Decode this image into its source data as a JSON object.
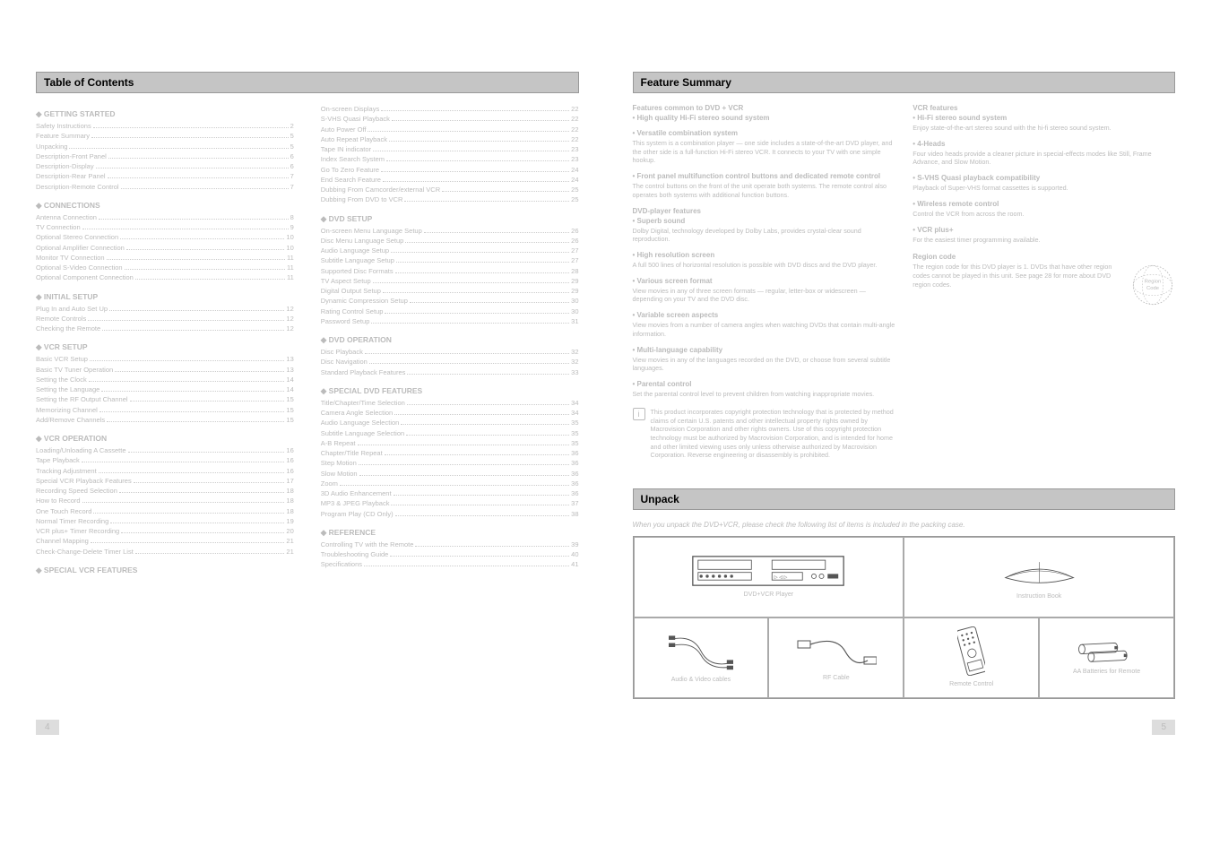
{
  "left": {
    "header": "Table of Contents",
    "sections": [
      {
        "title": "GETTING STARTED",
        "items": [
          {
            "label": "Safety Instructions",
            "page": "2"
          },
          {
            "label": "Feature Summary",
            "page": "5"
          },
          {
            "label": "Unpacking",
            "page": "5"
          },
          {
            "label": "Description-Front Panel",
            "page": "6"
          },
          {
            "label": "Description-Display",
            "page": "6"
          },
          {
            "label": "Description-Rear Panel",
            "page": "7"
          },
          {
            "label": "Description-Remote Control",
            "page": "7"
          }
        ]
      },
      {
        "title": "CONNECTIONS",
        "items": [
          {
            "label": "Antenna Connection",
            "page": "8"
          },
          {
            "label": "TV Connection",
            "page": "9"
          },
          {
            "label": "Optional Stereo Connection",
            "page": "10"
          },
          {
            "label": "Optional Amplifier Connection",
            "page": "10"
          },
          {
            "label": "Monitor TV Connection",
            "page": "11"
          },
          {
            "label": "Optional S-Video Connection",
            "page": "11"
          },
          {
            "label": "Optional Component Connection",
            "page": "11"
          }
        ]
      },
      {
        "title": "INITIAL SETUP",
        "items": [
          {
            "label": "Plug In and Auto Set Up",
            "page": "12"
          },
          {
            "label": "Remote Controls",
            "page": "12"
          },
          {
            "label": "Checking the Remote",
            "page": "12"
          }
        ]
      },
      {
        "title": "VCR SETUP",
        "items": [
          {
            "label": "Basic VCR Setup",
            "page": "13"
          },
          {
            "label": "Basic TV Tuner Operation",
            "page": "13"
          },
          {
            "label": "Setting the Clock",
            "page": "14"
          },
          {
            "label": "Setting the Language",
            "page": "14"
          },
          {
            "label": "Setting the RF Output Channel",
            "page": "15"
          },
          {
            "label": "Memorizing Channel",
            "page": "15"
          },
          {
            "label": "Add/Remove Channels",
            "page": "15"
          }
        ]
      },
      {
        "title": "VCR OPERATION",
        "items": [
          {
            "label": "Loading/Unloading A Cassette",
            "page": "16"
          },
          {
            "label": "Tape Playback",
            "page": "16"
          },
          {
            "label": "Tracking Adjustment",
            "page": "16"
          },
          {
            "label": "Special VCR Playback Features",
            "page": "17"
          },
          {
            "label": "Recording Speed Selection",
            "page": "18"
          },
          {
            "label": "How to Record",
            "page": "18"
          },
          {
            "label": "One Touch Record",
            "page": "18"
          },
          {
            "label": "Normal Timer Recording",
            "page": "19"
          },
          {
            "label": "VCR plus+ Timer Recording",
            "page": "20"
          },
          {
            "label": "Channel Mapping",
            "page": "21"
          },
          {
            "label": "Check-Change-Delete Timer List",
            "page": "21"
          }
        ]
      },
      {
        "title": "SPECIAL VCR FEATURES",
        "items": [
          {
            "label": "On-screen Displays",
            "page": "22"
          },
          {
            "label": "S-VHS Quasi Playback",
            "page": "22"
          },
          {
            "label": "Auto Power Off",
            "page": "22"
          },
          {
            "label": "Auto Repeat Playback",
            "page": "22"
          },
          {
            "label": "Tape IN indicator",
            "page": "23"
          },
          {
            "label": "Index Search System",
            "page": "23"
          },
          {
            "label": "Go To Zero Feature",
            "page": "24"
          },
          {
            "label": "End Search Feature",
            "page": "24"
          },
          {
            "label": "Dubbing From Camcorder/external VCR",
            "page": "25"
          },
          {
            "label": "Dubbing From DVD to VCR",
            "page": "25"
          }
        ]
      },
      {
        "title": "DVD SETUP",
        "items": [
          {
            "label": "On-screen Menu Language Setup",
            "page": "26"
          },
          {
            "label": "Disc Menu Language Setup",
            "page": "26"
          },
          {
            "label": "Audio Language Setup",
            "page": "27"
          },
          {
            "label": "Subtitle Language Setup",
            "page": "27"
          },
          {
            "label": "Supported Disc Formats",
            "page": "28"
          },
          {
            "label": "TV Aspect Setup",
            "page": "29"
          },
          {
            "label": "Digital Output Setup",
            "page": "29"
          },
          {
            "label": "Dynamic Compression Setup",
            "page": "30"
          },
          {
            "label": "Rating Control Setup",
            "page": "30"
          },
          {
            "label": "Password Setup",
            "page": "31"
          }
        ]
      },
      {
        "title": "DVD OPERATION",
        "items": [
          {
            "label": "Disc Playback",
            "page": "32"
          },
          {
            "label": "Disc Navigation",
            "page": "32"
          },
          {
            "label": "Standard Playback Features",
            "page": "33"
          }
        ]
      },
      {
        "title": "SPECIAL DVD FEATURES",
        "items": [
          {
            "label": "Title/Chapter/Time Selection",
            "page": "34"
          },
          {
            "label": "Camera Angle Selection",
            "page": "34"
          },
          {
            "label": "Audio Language Selection",
            "page": "35"
          },
          {
            "label": "Subtitle Language Selection",
            "page": "35"
          },
          {
            "label": "A-B Repeat",
            "page": "35"
          },
          {
            "label": "Chapter/Title Repeat",
            "page": "36"
          },
          {
            "label": "Step Motion",
            "page": "36"
          },
          {
            "label": "Slow Motion",
            "page": "36"
          },
          {
            "label": "Zoom",
            "page": "36"
          },
          {
            "label": "3D Audio Enhancement",
            "page": "36"
          },
          {
            "label": "MP3 & JPEG Playback",
            "page": "37"
          },
          {
            "label": "Program Play (CD Only)",
            "page": "38"
          }
        ]
      },
      {
        "title": "REFERENCE",
        "items": [
          {
            "label": "Controlling TV with the Remote",
            "page": "39"
          },
          {
            "label": "Troubleshooting Guide",
            "page": "40"
          },
          {
            "label": "Specifications",
            "page": "41"
          }
        ]
      }
    ],
    "pageNumber": "4"
  },
  "right": {
    "header": "Feature Summary",
    "intro_title": "Features common to DVD + VCR",
    "features": [
      {
        "title": "High quality Hi-Fi stereo sound system",
        "body": ""
      },
      {
        "title": "Versatile combination system",
        "body": "This system is a combination player — one side includes a state-of-the-art DVD player, and the other side is a full-function Hi-Fi stereo VCR. It connects to your TV with one simple hookup."
      },
      {
        "title": "Front panel multifunction control buttons and dedicated remote control",
        "body": "The control buttons on the front of the unit operate both systems. The remote control also operates both systems with additional function buttons."
      }
    ],
    "dvd_title": "DVD-player features",
    "dvd": [
      {
        "title": "Superb sound",
        "body": "Dolby Digital, technology developed by Dolby Labs, provides crystal-clear sound reproduction."
      },
      {
        "title": "High resolution screen",
        "body": "A full 500 lines of horizontal resolution is possible with DVD discs and the DVD player."
      },
      {
        "title": "Various screen format",
        "body": "View movies in any of three screen formats — regular, letter-box or widescreen — depending on your TV and the DVD disc."
      },
      {
        "title": "Variable screen aspects",
        "body": "View movies from a number of camera angles when watching DVDs that contain multi-angle information."
      },
      {
        "title": "Multi-language capability",
        "body": "View movies in any of the languages recorded on the DVD, or choose from several subtitle languages."
      },
      {
        "title": "Parental control",
        "body": "Set the parental control level to prevent children from watching inappropriate movies."
      }
    ],
    "vcr_title": "VCR features",
    "vcr": [
      {
        "title": "Hi-Fi stereo sound system",
        "body": "Enjoy state-of-the-art stereo sound with the hi-fi stereo sound system."
      },
      {
        "title": "4-Heads",
        "body": "Four video heads provide a cleaner picture in special-effects modes like Still, Frame Advance, and Slow Motion."
      },
      {
        "title": "S-VHS Quasi playback compatibility",
        "body": "Playback of Super-VHS format cassettes is supported."
      },
      {
        "title": "Wireless remote control",
        "body": "Control the VCR from across the room."
      },
      {
        "title": "VCR plus+",
        "body": "For the easiest timer programming available."
      }
    ],
    "note": "This product incorporates copyright protection technology that is protected by method claims of certain U.S. patents and other intellectual property rights owned by Macrovision Corporation and other rights owners. Use of this copyright protection technology must be authorized by Macrovision Corporation, and is intended for home and other limited viewing uses only unless otherwise authorized by Macrovision Corporation. Reverse engineering or disassembly is prohibited.",
    "region_title": "Region code",
    "region_body": "Region\nCode",
    "region_text": "The region code for this DVD player is 1. DVDs that have other region codes cannot be played in this unit. See page 28 for more about DVD region codes.",
    "unpack_header": "Unpack",
    "unpack_intro": "When you unpack the DVD+VCR, please check the following list of items is included in the packing case.",
    "cells": [
      {
        "label": "DVD+VCR Player"
      },
      {
        "label": "Instruction Book"
      },
      {
        "label": "Audio & Video cables"
      },
      {
        "label": "RF Cable"
      },
      {
        "label": "Remote Control"
      },
      {
        "label": "AA Batteries for Remote"
      }
    ],
    "pageNumber": "5"
  }
}
